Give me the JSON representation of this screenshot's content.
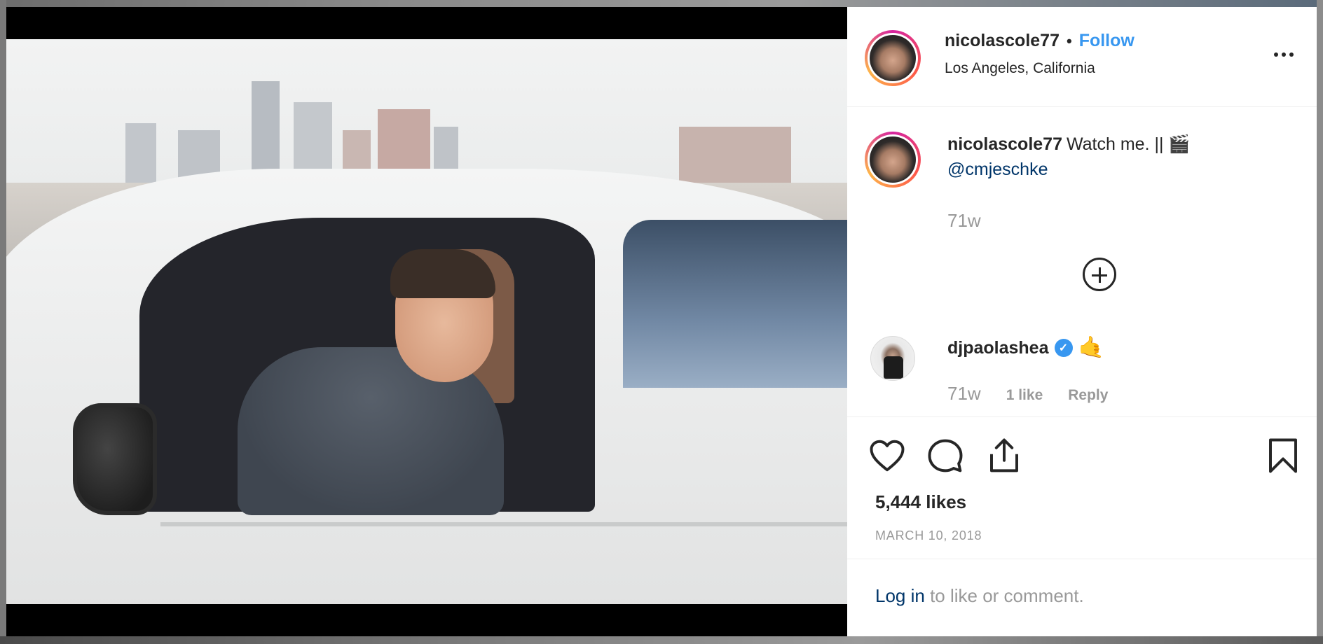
{
  "post": {
    "username": "nicolascole77",
    "separator": "•",
    "follow_label": "Follow",
    "location": "Los Angeles, California",
    "more_label": "More options",
    "photo_alt": "Man sitting in white car with city skyline behind"
  },
  "caption": {
    "username": "nicolascole77",
    "text": "Watch me. || 🎬",
    "mention": "@cmjeschke",
    "time": "71w"
  },
  "comment": {
    "username": "djpaolashea",
    "verified_mark": "✓",
    "text": "🤙",
    "time": "71w",
    "likes": "1 like",
    "reply_label": "Reply"
  },
  "actions": {
    "icons": [
      "heart-icon",
      "comment-icon",
      "share-icon",
      "bookmark-icon"
    ]
  },
  "likes": "5,444 likes",
  "date": "MARCH 10, 2018",
  "login": {
    "link": "Log in",
    "rest": " to like or comment."
  },
  "colors": {
    "link_blue": "#3897f0",
    "mention_navy": "#003569",
    "text": "#262626",
    "muted": "#999999"
  }
}
